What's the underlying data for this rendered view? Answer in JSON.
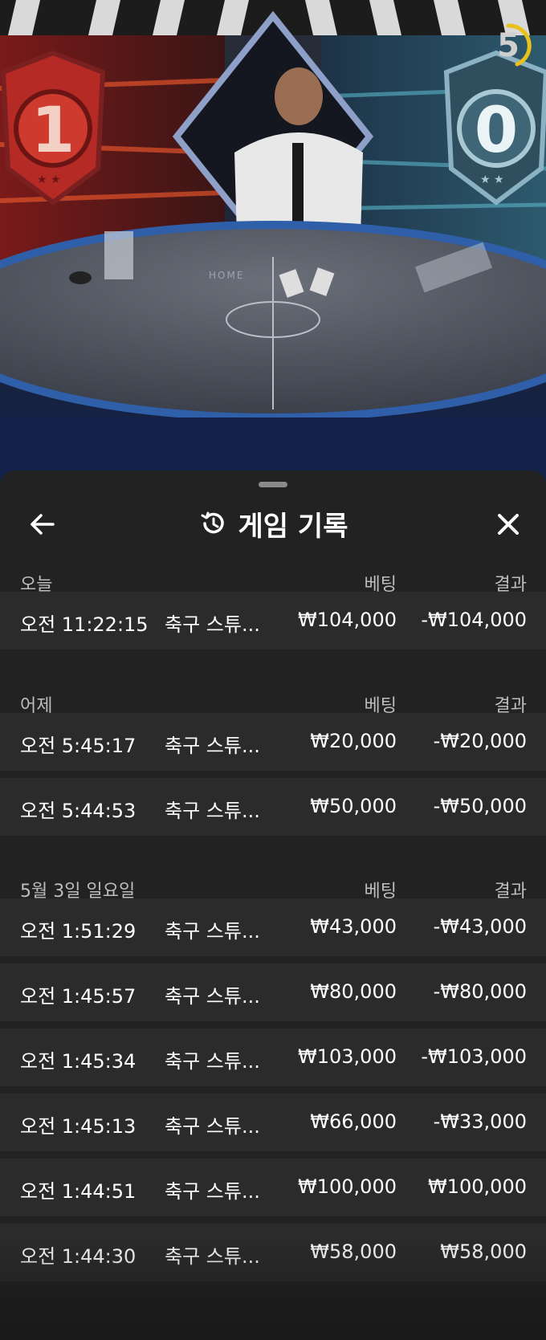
{
  "video": {
    "home_score": "1",
    "away_score": "0",
    "countdown": "5",
    "table_text": "HOME"
  },
  "history": {
    "title": "게임 기록",
    "icons": {
      "back": "back-arrow-icon",
      "history": "history-clock-icon",
      "close": "close-icon"
    },
    "sections": [
      {
        "label": "오늘",
        "bet_header": "베팅",
        "result_header": "결과",
        "rows": [
          {
            "time": "오전 11:22:15",
            "game": "축구 스튜...",
            "bet": "₩104,000",
            "result": "-₩104,000"
          }
        ]
      },
      {
        "label": "어제",
        "bet_header": "베팅",
        "result_header": "결과",
        "rows": [
          {
            "time": "오전 5:45:17",
            "game": "축구 스튜...",
            "bet": "₩20,000",
            "result": "-₩20,000"
          },
          {
            "time": "오전 5:44:53",
            "game": "축구 스튜...",
            "bet": "₩50,000",
            "result": "-₩50,000"
          }
        ]
      },
      {
        "label": "5월 3일 일요일",
        "bet_header": "베팅",
        "result_header": "결과",
        "rows": [
          {
            "time": "오전 1:51:29",
            "game": "축구 스튜...",
            "bet": "₩43,000",
            "result": "-₩43,000"
          },
          {
            "time": "오전 1:45:57",
            "game": "축구 스튜...",
            "bet": "₩80,000",
            "result": "-₩80,000"
          },
          {
            "time": "오전 1:45:34",
            "game": "축구 스튜...",
            "bet": "₩103,000",
            "result": "-₩103,000"
          },
          {
            "time": "오전 1:45:13",
            "game": "축구 스튜...",
            "bet": "₩66,000",
            "result": "-₩33,000"
          },
          {
            "time": "오전 1:44:51",
            "game": "축구 스튜...",
            "bet": "₩100,000",
            "result": "₩100,000"
          },
          {
            "time": "오전 1:44:30",
            "game": "축구 스튜...",
            "bet": "₩58,000",
            "result": "₩58,000"
          }
        ]
      }
    ]
  }
}
